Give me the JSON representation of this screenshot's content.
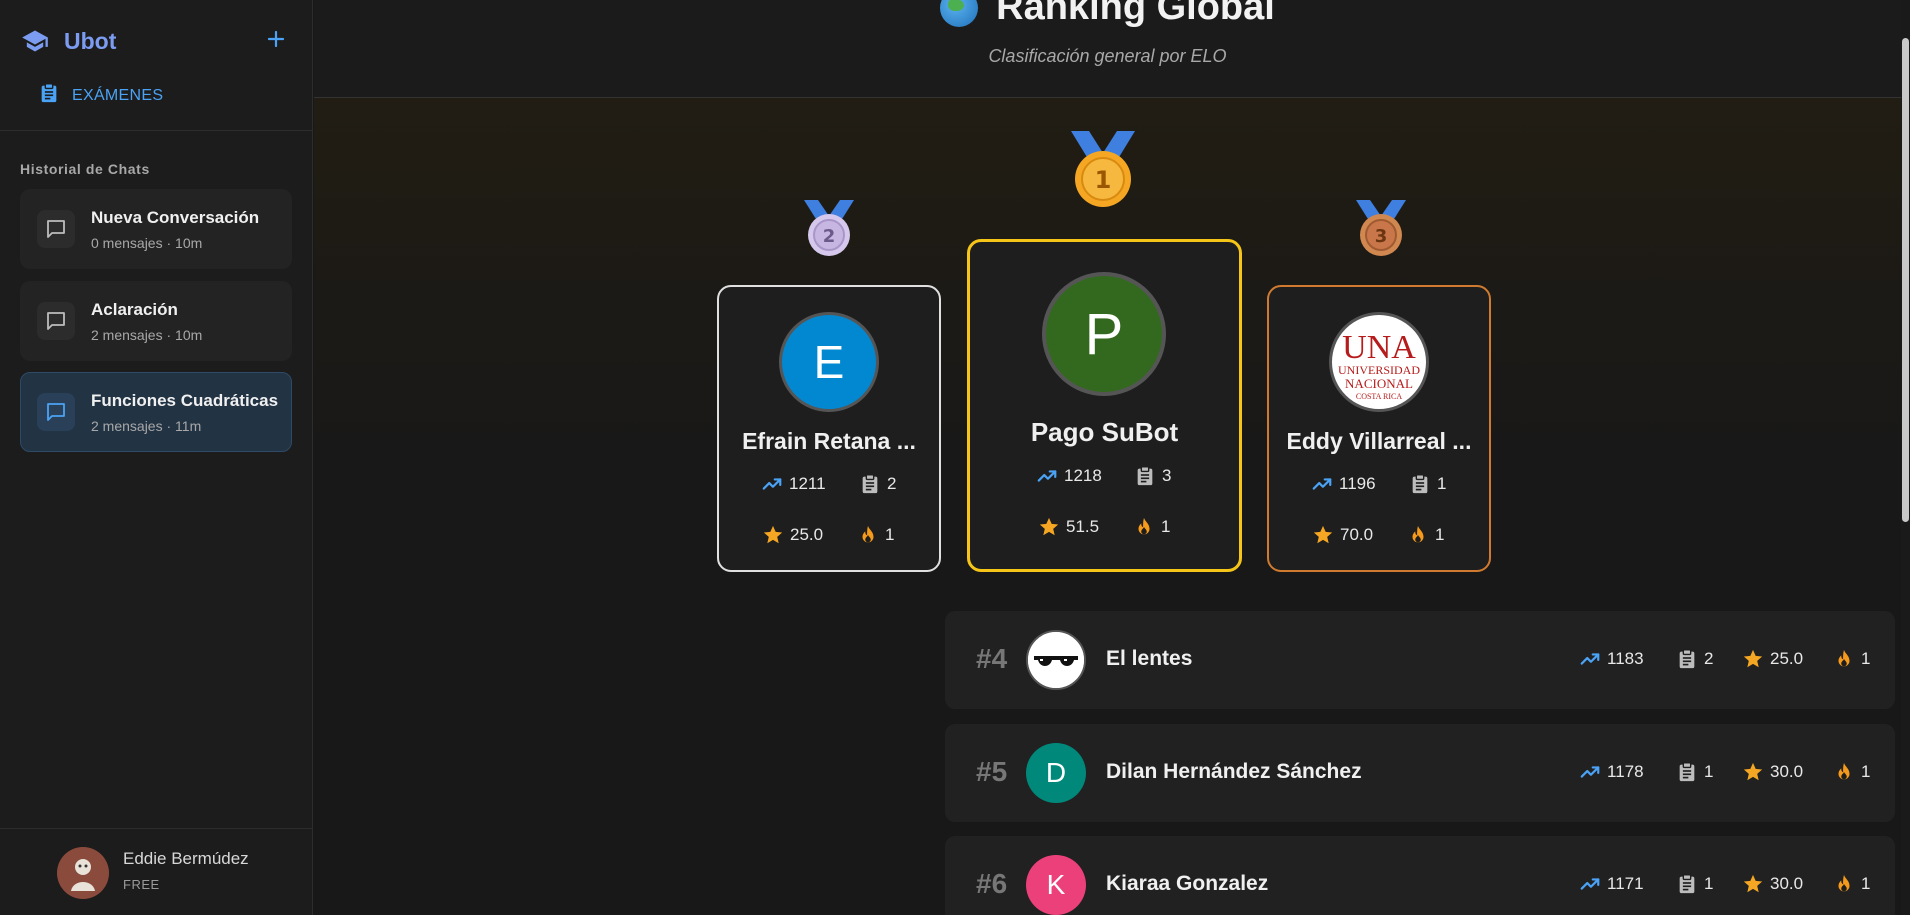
{
  "app": {
    "name": "Ubot"
  },
  "sidebar": {
    "exams_label": "EXÁMENES",
    "history_title": "Historial de Chats",
    "chats": [
      {
        "title": "Nueva Conversación",
        "meta": "0 mensajes · 10m",
        "active": false
      },
      {
        "title": "Aclaración",
        "meta": "2 mensajes · 10m",
        "active": false
      },
      {
        "title": "Funciones Cuadráticas",
        "meta": "2 mensajes · 11m",
        "active": true
      }
    ],
    "user": {
      "name": "Eddie Bermúdez",
      "plan": "FREE"
    }
  },
  "header": {
    "title": "Ranking Global",
    "subtitle": "Clasificación general por ELO"
  },
  "podium": [
    {
      "rank": "1",
      "initial": "P",
      "name": "Pago SuBot",
      "elo": "1218",
      "exams": "3",
      "score": "51.5",
      "streak": "1",
      "avatar_color": "#33691e",
      "medal_color": "#f5a623"
    },
    {
      "rank": "2",
      "initial": "E",
      "name": "Efrain Retana ...",
      "elo": "1211",
      "exams": "2",
      "score": "25.0",
      "streak": "1",
      "avatar_color": "#0288d1",
      "medal_color": "#c8b6e2"
    },
    {
      "rank": "3",
      "initial": "UNA",
      "name": "Eddy Villarreal ...",
      "elo": "1196",
      "exams": "1",
      "score": "70.0",
      "streak": "1",
      "avatar_color": "#ffffff",
      "medal_color": "#c8764a"
    }
  ],
  "rows": [
    {
      "rank": "#4",
      "initial": "",
      "name": "El lentes",
      "elo": "1183",
      "exams": "2",
      "score": "25.0",
      "streak": "1",
      "avatar_color": "#ffffff"
    },
    {
      "rank": "#5",
      "initial": "D",
      "name": "Dilan Hernández Sánchez",
      "elo": "1178",
      "exams": "1",
      "score": "30.0",
      "streak": "1",
      "avatar_color": "#00897b"
    },
    {
      "rank": "#6",
      "initial": "K",
      "name": "Kiaraa Gonzalez",
      "elo": "1171",
      "exams": "1",
      "score": "30.0",
      "streak": "1",
      "avatar_color": "#ec407a"
    }
  ],
  "colors": {
    "accent": "#4aa3f5",
    "gold": "#f5c518",
    "silver": "#e0e0e0",
    "bronze": "#d07a30",
    "star": "#f5a623"
  },
  "icons": {
    "brand": "graduation-cap-icon",
    "exams": "clipboard-icon",
    "chat": "chat-bubble-icon",
    "elo": "trending-up-icon",
    "score": "star-icon",
    "streak": "fire-icon"
  }
}
